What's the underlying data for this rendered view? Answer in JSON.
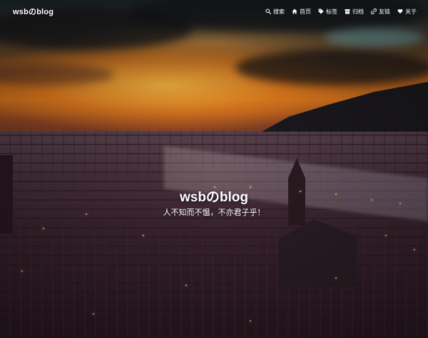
{
  "navbar": {
    "brand": "wsbのblog",
    "menu": [
      {
        "icon": "search-icon",
        "label": "搜索"
      },
      {
        "icon": "home-icon",
        "label": "首页"
      },
      {
        "icon": "tag-icon",
        "label": "标签"
      },
      {
        "icon": "archive-icon",
        "label": "归档"
      },
      {
        "icon": "link-icon",
        "label": "友链"
      },
      {
        "icon": "heart-icon",
        "label": "关于"
      }
    ]
  },
  "hero": {
    "title": "wsbのblog",
    "subtitle": "人不知而不愠，不亦君子乎！"
  }
}
